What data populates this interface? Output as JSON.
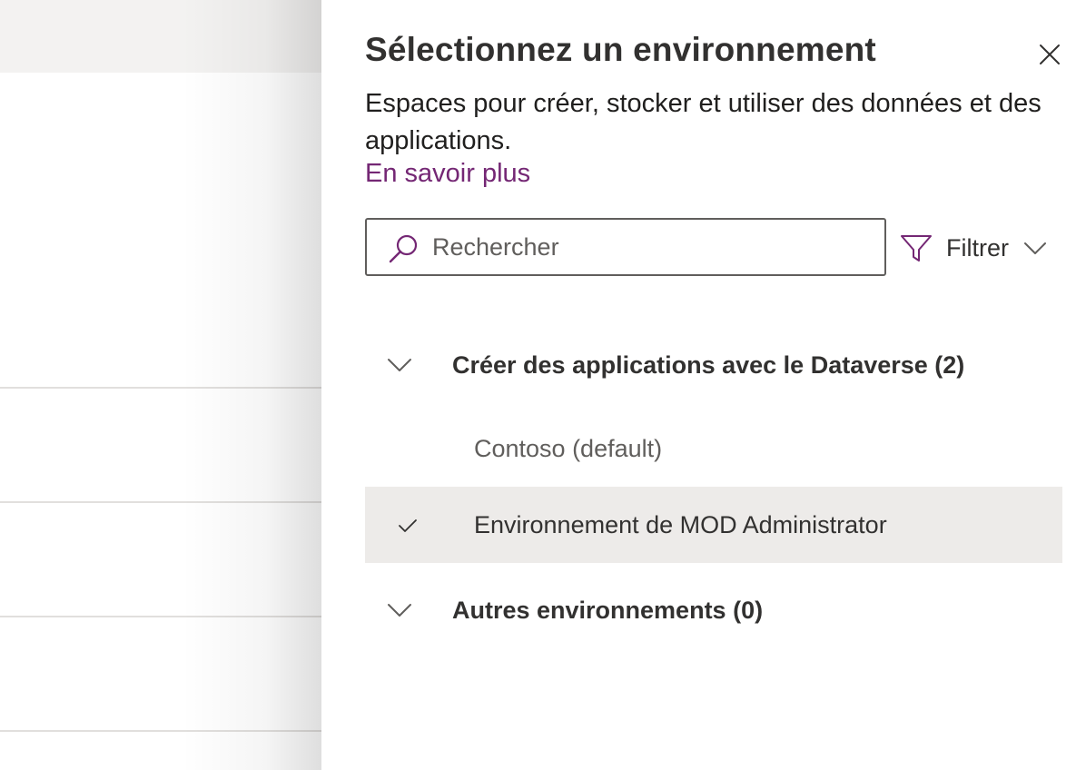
{
  "panel": {
    "title": "Sélectionnez un environnement",
    "description": "Espaces pour créer, stocker et utiliser des données et des applications.",
    "learn_more": "En savoir plus",
    "close_icon": "close-icon",
    "accent_color": "#742774"
  },
  "search": {
    "placeholder": "Rechercher",
    "value": "",
    "icon": "search-icon"
  },
  "filter": {
    "label": "Filtrer",
    "icon": "filter-icon"
  },
  "groups": [
    {
      "label": "Créer des applications avec le Dataverse (2)",
      "expanded": true,
      "items": [
        {
          "label": "Contoso (default)",
          "selected": false
        },
        {
          "label": "Environnement de MOD Administrator",
          "selected": true
        }
      ]
    },
    {
      "label": "Autres environnements (0)",
      "expanded": true,
      "items": []
    }
  ]
}
